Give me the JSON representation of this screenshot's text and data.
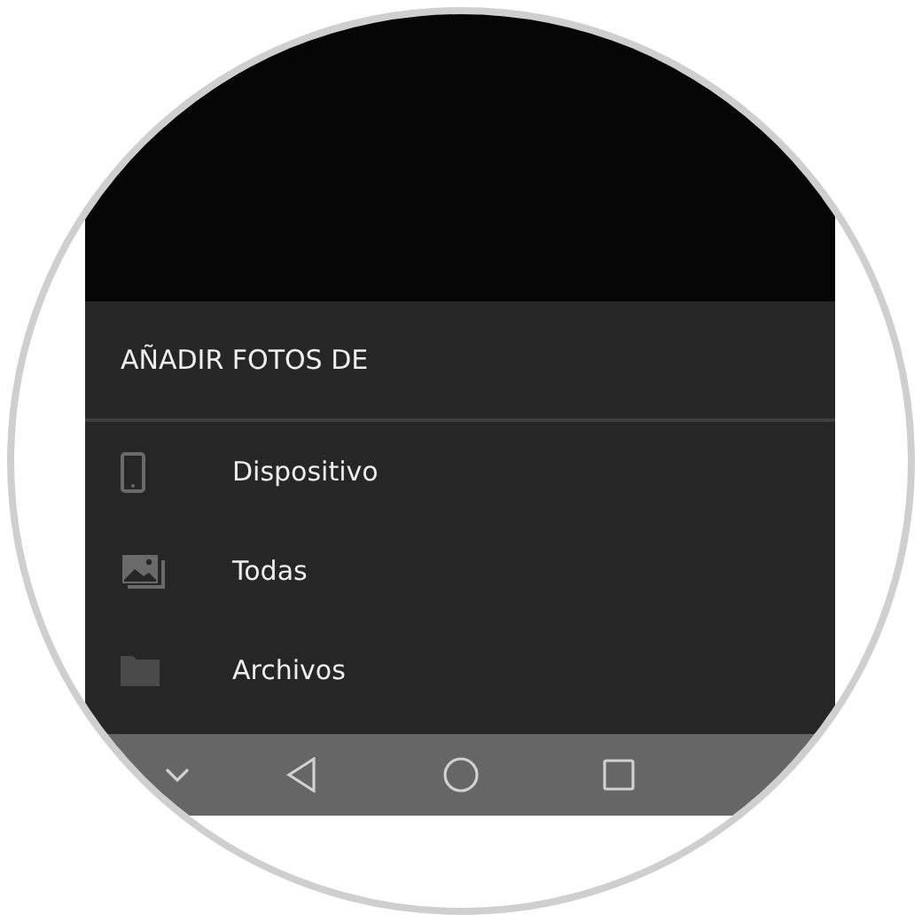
{
  "sheet": {
    "title": "AÑADIR FOTOS DE",
    "items": [
      {
        "kind": "phone",
        "label": "Dispositivo"
      },
      {
        "kind": "pictures",
        "label": "Todas"
      },
      {
        "kind": "folder",
        "label": "Archivos"
      }
    ]
  },
  "nav_bar": [
    {
      "kind": "hide"
    },
    {
      "kind": "back"
    },
    {
      "kind": "home"
    },
    {
      "kind": "recent"
    }
  ]
}
